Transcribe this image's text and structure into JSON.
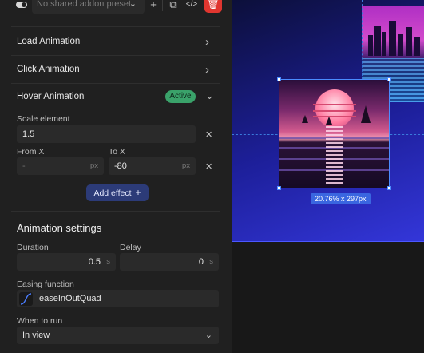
{
  "toolbar": {
    "preset_placeholder": "No shared addon preset",
    "icons": [
      "toggle-icon",
      "chevron-down-icon",
      "plus-icon",
      "copy-icon",
      "code-icon",
      "trash-icon"
    ],
    "plus_glyph": "+",
    "copy_glyph": "⧉",
    "code_glyph": "</>",
    "trash_glyph": "🗑",
    "chevron_glyph": "⌄"
  },
  "sections": {
    "load": "Load Animation",
    "click": "Click Animation",
    "hover": "Hover Animation",
    "hover_badge": "Active",
    "chevron_right": "›",
    "chevron_down": "⌄"
  },
  "hover": {
    "scale_label": "Scale element",
    "scale_value": "1.5",
    "from_x_label": "From X",
    "from_x_value": "-",
    "to_x_label": "To X",
    "to_x_value": "-80",
    "unit": "px",
    "clear_glyph": "✕",
    "add_effect_label": "Add effect",
    "add_effect_glyph": "+"
  },
  "animation_settings": {
    "heading": "Animation settings",
    "duration_label": "Duration",
    "duration_value": "0.5",
    "duration_unit": "s",
    "delay_label": "Delay",
    "delay_value": "0",
    "delay_unit": "s",
    "easing_label": "Easing function",
    "easing_value": "easeInOutQuad",
    "when_label": "When to run",
    "when_value": "In view"
  },
  "canvas": {
    "dimension_badge": "20.76% x 297px",
    "colors": {
      "artboard": "#1d1f9a",
      "selection": "#4b8cff",
      "badge": "#3a66e0"
    }
  },
  "colors": {
    "panel": "#202020",
    "field": "#2a2a2a",
    "active_badge": "#3aa26a",
    "add_effect": "#2c3b78",
    "delete": "#e0362f"
  }
}
